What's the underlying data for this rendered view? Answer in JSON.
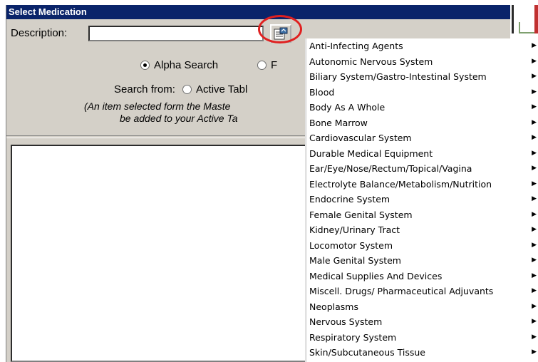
{
  "window": {
    "title": "Select Medication"
  },
  "description": {
    "label": "Description:",
    "value": ""
  },
  "lookup_button": {
    "icon": "lookup-list-icon"
  },
  "search_type": {
    "options": [
      {
        "label": "Alpha Search",
        "checked": true
      },
      {
        "label": "F",
        "checked": false
      }
    ]
  },
  "search_from": {
    "label": "Search from:",
    "options": [
      {
        "label": "Active Tabl",
        "checked": false
      }
    ]
  },
  "note": {
    "line1": "(An item selected form the Maste",
    "line2": "be added to your Active Ta"
  },
  "menu": {
    "submenu_arrow": "▶",
    "items": [
      "Anti-Infecting Agents",
      "Autonomic Nervous System",
      "Biliary System/Gastro-Intestinal System",
      "Blood",
      "Body As A Whole",
      "Bone Marrow",
      "Cardiovascular System",
      "Durable Medical Equipment",
      "Ear/Eye/Nose/Rectum/Topical/Vagina",
      "Electrolyte Balance/Metabolism/Nutrition",
      "Endocrine System",
      "Female Genital System",
      "Kidney/Urinary Tract",
      "Locomotor System",
      "Male Genital System",
      "Medical Supplies And Devices",
      "Miscell. Drugs/ Pharmaceutical Adjuvants",
      "Neoplasms",
      "Nervous System",
      "Respiratory System",
      "Skin/Subcutaneous Tissue"
    ]
  },
  "colors": {
    "titlebar": "#0a246a",
    "highlight": "#e02020",
    "dialog": "#d4d0c8"
  }
}
